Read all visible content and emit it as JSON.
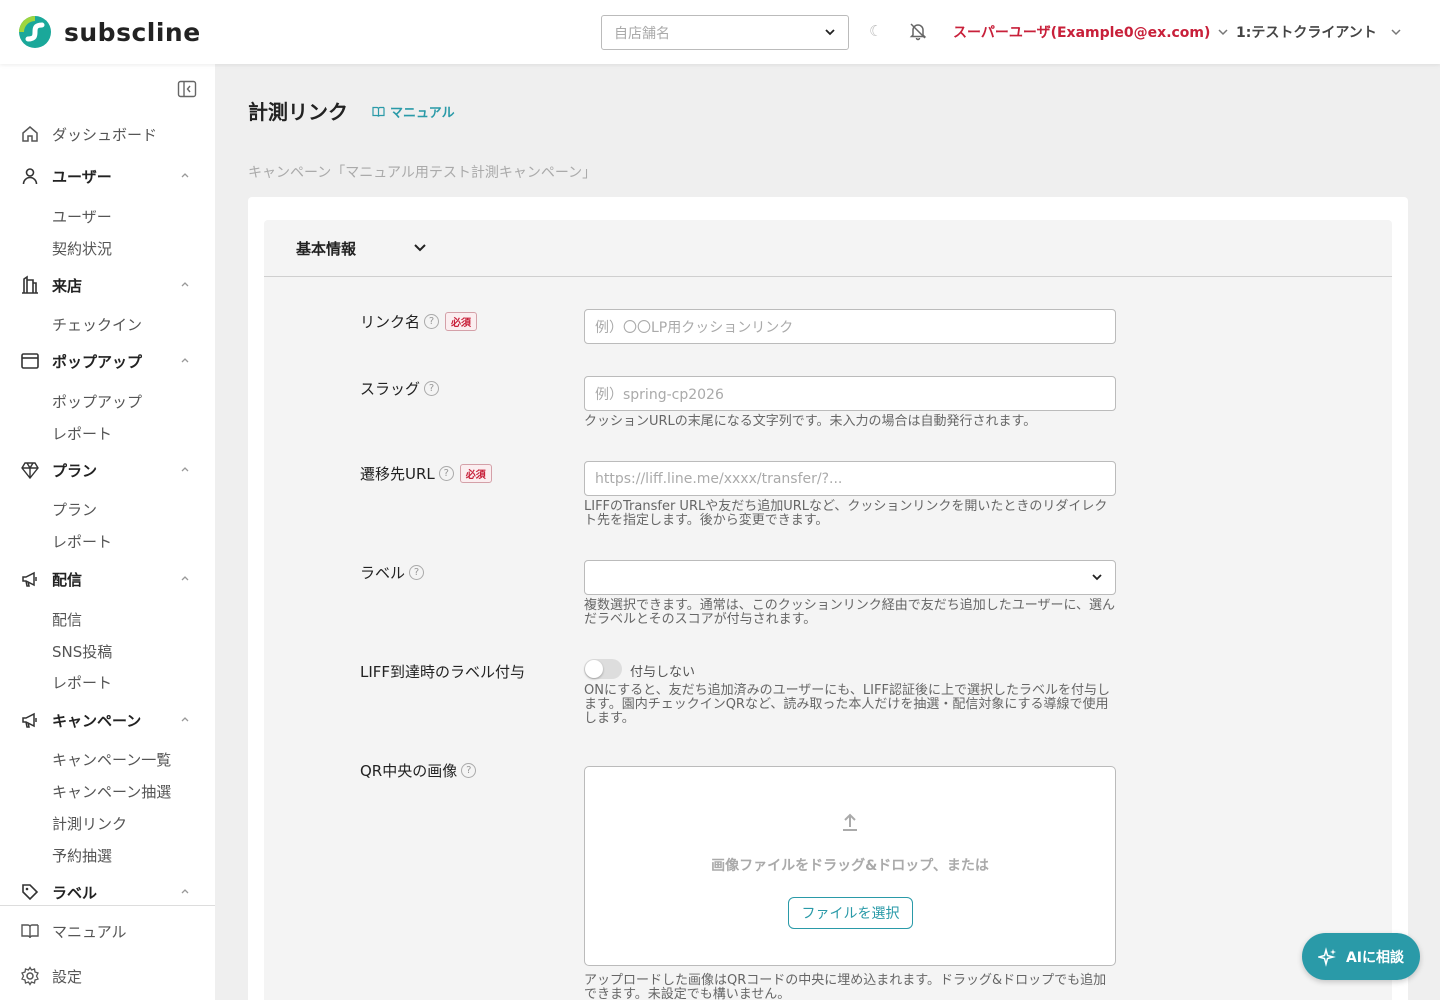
{
  "header": {
    "logo_text": "subscline",
    "store_placeholder": "自店舗名",
    "user_label": "スーパーユーザ(Example0@ex.com)",
    "client_label": "1:テストクライアント"
  },
  "sidebar": {
    "dashboard": "ダッシュボード",
    "groups": [
      {
        "label": "ユーザー",
        "items": [
          "ユーザー",
          "契約状況"
        ]
      },
      {
        "label": "来店",
        "items": [
          "チェックイン"
        ]
      },
      {
        "label": "ポップアップ",
        "items": [
          "ポップアップ",
          "レポート"
        ]
      },
      {
        "label": "プラン",
        "items": [
          "プラン",
          "レポート"
        ]
      },
      {
        "label": "配信",
        "items": [
          "配信",
          "SNS投稿",
          "レポート"
        ]
      },
      {
        "label": "キャンペーン",
        "items": [
          "キャンペーン一覧",
          "キャンペーン抽選",
          "計測リンク",
          "予約抽選"
        ]
      },
      {
        "label": "ラベル",
        "items": []
      }
    ],
    "footer": [
      "マニュアル",
      "設定"
    ]
  },
  "main": {
    "title": "計測リンク",
    "manual_link": "マニュアル",
    "breadcrumb": "キャンペーン「マニュアル用テスト計測キャンペーン」",
    "section_title": "基本情報",
    "required_badge": "必須",
    "help_mark": "?",
    "fields": {
      "link_name": {
        "label": "リンク名",
        "placeholder": "例）〇〇LP用クッションリンク"
      },
      "slug": {
        "label": "スラッグ",
        "placeholder": "例）spring-cp2026",
        "hint": "クッションURLの末尾になる文字列です。未入力の場合は自動発行されます。"
      },
      "redirect_url": {
        "label": "遷移先URL",
        "placeholder": "https://liff.line.me/xxxx/transfer/?...",
        "hint": "LIFFのTransfer URLや友だち追加URLなど、クッションリンクを開いたときのリダイレクト先を指定します。後から変更できます。"
      },
      "label_select": {
        "label": "ラベル",
        "hint": "複数選択できます。通常は、このクッションリンク経由で友だち追加したユーザーに、選んだラベルとそのスコアが付与されます。"
      },
      "liff_label": {
        "label": "LIFF到達時のラベル付与",
        "toggle_text": "付与しない",
        "toggle_on": false,
        "hint": "ONにすると、友だち追加済みのユーザーにも、LIFF認証後に上で選択したラベルを付与します。園内チェックインQRなど、読み取った本人だけを抽選・配信対象にする導線で使用します。"
      },
      "qr_image": {
        "label": "QR中央の画像",
        "drop_text": "画像ファイルをドラッグ&ドロップ、または",
        "button": "ファイルを選択",
        "hint": "アップロードした画像はQRコードの中央に埋め込まれます。ドラッグ&ドロップでも追加できます。未設定でも構いません。"
      }
    }
  },
  "ai_button": "AIに相談",
  "colors": {
    "accent": "#2a9aa8",
    "alert": "#c8203a"
  }
}
